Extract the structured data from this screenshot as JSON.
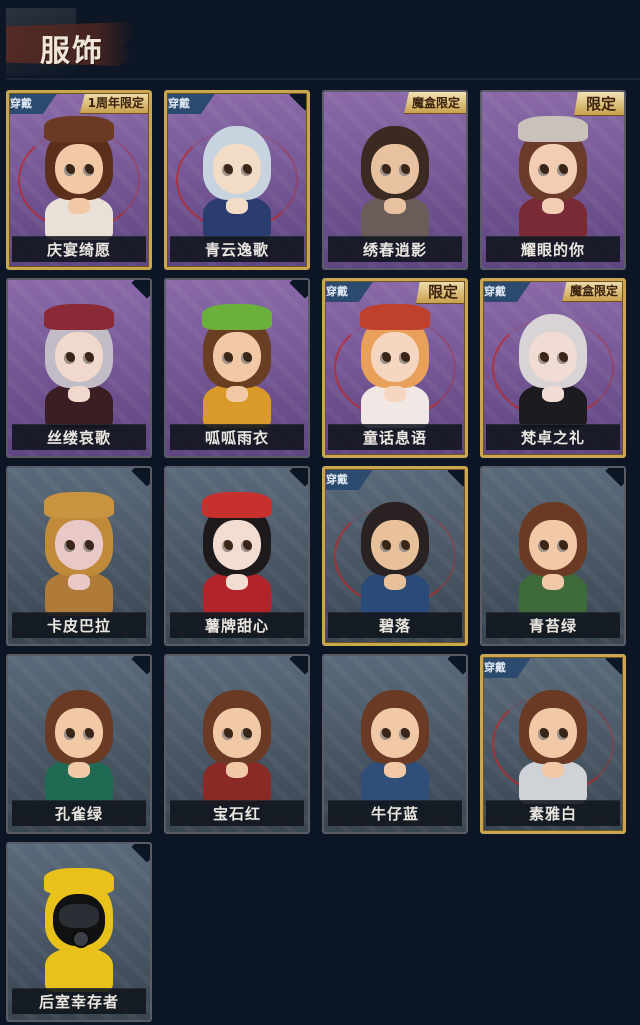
{
  "page": {
    "title": "服饰"
  },
  "cards": [
    {
      "name": "庆宴绮愿",
      "worn": true,
      "tag": "周年限定",
      "tag_prefix": "1",
      "theme": "purple",
      "hair": "#5a2f1c",
      "skin": "#f1c9a6",
      "cloth": "#e9e1d6",
      "hat": "#6b3a22",
      "hat_on": true
    },
    {
      "name": "青云逸歌",
      "worn": true,
      "tag": "",
      "theme": "purple",
      "hair": "#c8d3e0",
      "skin": "#f3dcc6",
      "cloth": "#2b3c6e",
      "hat_on": false
    },
    {
      "name": "绣春逍影",
      "worn": false,
      "tag": "魔盒限定",
      "theme": "purple",
      "hair": "#3a2a22",
      "skin": "#e8c2a0",
      "cloth": "#6a5c58",
      "hat_on": false
    },
    {
      "name": "耀眼的你",
      "worn": false,
      "tag": "限定",
      "theme": "purple",
      "hair": "#6a3a2a",
      "skin": "#f2cdb4",
      "cloth": "#7a2a34",
      "hat": "#c9c2ba",
      "hat_on": true
    },
    {
      "name": "丝缕哀歌",
      "worn": false,
      "tag": "",
      "theme": "purple",
      "hair": "#c2bcc6",
      "skin": "#f0d8cc",
      "cloth": "#3a1e24",
      "hat": "#8a2a36",
      "hat_on": true
    },
    {
      "name": "呱呱雨衣",
      "worn": false,
      "tag": "",
      "theme": "purple",
      "hair": "#6a3e22",
      "skin": "#f1c9a6",
      "cloth": "#d99a2a",
      "hat": "#6bb03a",
      "hat_on": true
    },
    {
      "name": "童话息语",
      "worn": true,
      "tag": "限定",
      "theme": "purple",
      "hair": "#e8a05a",
      "skin": "#f5d6c0",
      "cloth": "#f1e8e6",
      "hat": "#c0402e",
      "hat_on": true
    },
    {
      "name": "梵卓之礼",
      "worn": true,
      "tag": "魔盒限定",
      "theme": "purple",
      "hair": "#d8d4d6",
      "skin": "#f0dcd2",
      "cloth": "#1e1a22",
      "hat_on": false
    },
    {
      "name": "卡皮巴拉",
      "worn": false,
      "tag": "",
      "theme": "steel",
      "hair": "#c08a3a",
      "skin": "#e9c8c8",
      "cloth": "#b07a38",
      "hat": "#c89440",
      "hat_on": true
    },
    {
      "name": "薯牌甜心",
      "worn": false,
      "tag": "",
      "theme": "steel",
      "hair": "#1e1a1c",
      "skin": "#f3dcd0",
      "cloth": "#b0242a",
      "hat": "#c8302e",
      "hat_on": true
    },
    {
      "name": "碧落",
      "worn": true,
      "tag": "",
      "theme": "steel",
      "hair": "#2a2222",
      "skin": "#e8c09a",
      "cloth": "#2a4a7a",
      "hat_on": false
    },
    {
      "name": "青苔绿",
      "worn": false,
      "tag": "",
      "theme": "steel",
      "hair": "#6a3a24",
      "skin": "#f1c9a6",
      "cloth": "#3f6a3a",
      "hat_on": false
    },
    {
      "name": "孔雀绿",
      "worn": false,
      "tag": "",
      "theme": "steel",
      "hair": "#6a3a24",
      "skin": "#f1c9a6",
      "cloth": "#1f6a52",
      "hat_on": false
    },
    {
      "name": "宝石红",
      "worn": false,
      "tag": "",
      "theme": "steel",
      "hair": "#6a3a24",
      "skin": "#f1c9a6",
      "cloth": "#8a2a26",
      "hat_on": false
    },
    {
      "name": "牛仔蓝",
      "worn": false,
      "tag": "",
      "theme": "steel",
      "hair": "#6a3a24",
      "skin": "#f1c9a6",
      "cloth": "#2f4f7a",
      "hat_on": false
    },
    {
      "name": "素雅白",
      "worn": true,
      "tag": "",
      "theme": "steel",
      "hair": "#6a3a24",
      "skin": "#f1c9a6",
      "cloth": "#cfd2d6",
      "hat_on": false
    },
    {
      "name": "后室幸存者",
      "worn": false,
      "tag": "",
      "theme": "steel",
      "hair": "#e8c21a",
      "skin": "#e8c21a",
      "cloth": "#e8c21a",
      "hat": "#e8c21a",
      "hat_on": true,
      "hazmat": true
    }
  ],
  "labels": {
    "worn": "穿戴"
  },
  "colors": {
    "bg": "#0d1624",
    "purple_top": "#8a6aa8",
    "purple_bottom": "#5e4480",
    "steel_top": "#5a6a7a",
    "steel_bottom": "#3a4552",
    "gold": "#c9a64f"
  },
  "icons": {
    "worn-ribbon": "ribbon",
    "limit-tag": "gold-tag"
  }
}
